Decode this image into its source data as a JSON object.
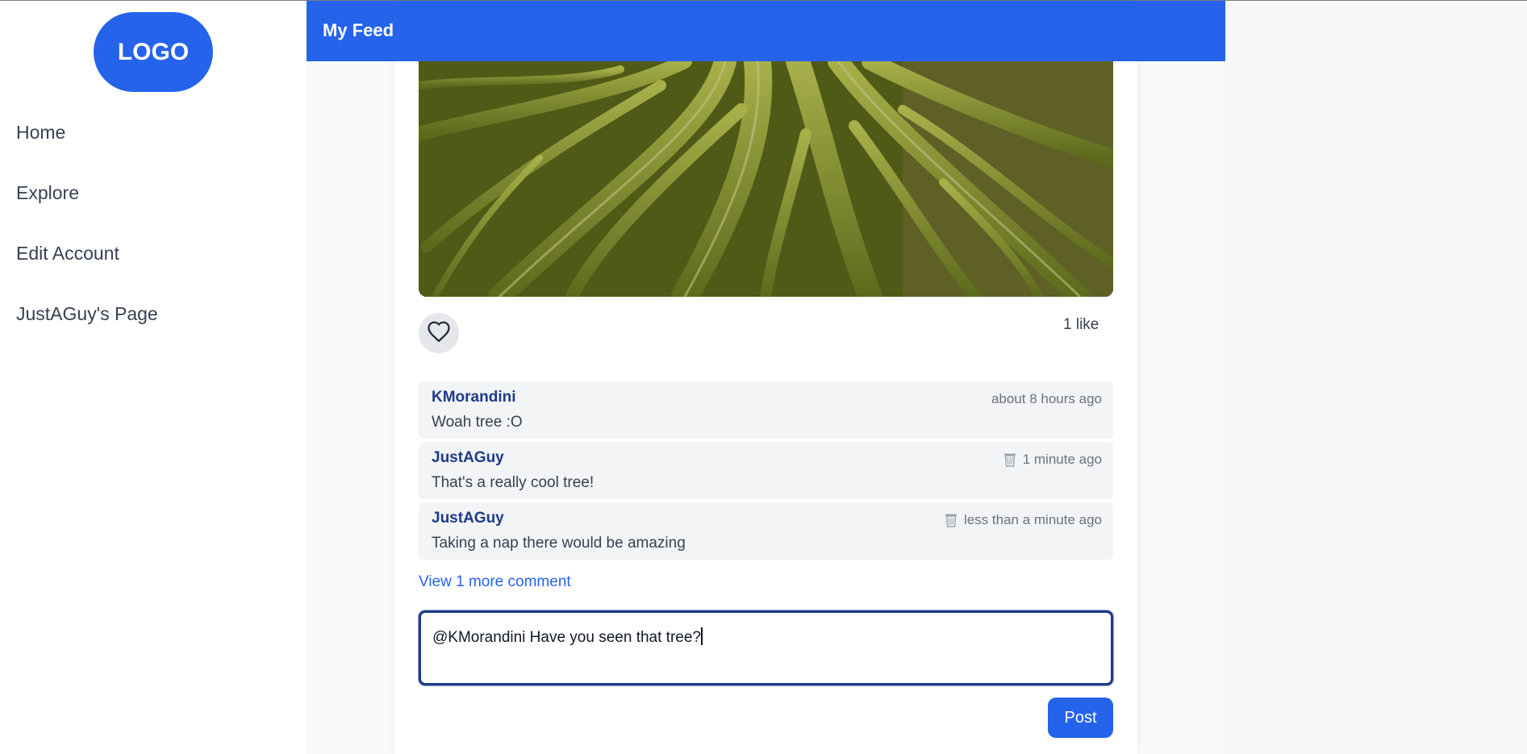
{
  "sidebar": {
    "logo": "LOGO",
    "items": [
      {
        "label": "Home"
      },
      {
        "label": "Explore"
      },
      {
        "label": "Edit Account"
      },
      {
        "label": "JustAGuy's Page"
      }
    ]
  },
  "header": {
    "title": "My Feed"
  },
  "post": {
    "likes": "1 like",
    "comments": [
      {
        "user": "KMorandini",
        "text": "Woah tree :O",
        "time": "about 8 hours ago",
        "deletable": false
      },
      {
        "user": "JustAGuy",
        "text": "That's a really cool tree!",
        "time": "1 minute ago",
        "deletable": true
      },
      {
        "user": "JustAGuy",
        "text": "Taking a nap there would be amazing",
        "time": "less than a minute ago",
        "deletable": true
      }
    ],
    "view_more": "View 1 more comment",
    "comment_input_value": "@KMorandini Have you seen that tree?",
    "post_button": "Post"
  },
  "colors": {
    "accent": "#2563eb",
    "username": "#1e3a8a"
  },
  "icons": {
    "like": "heart-icon",
    "delete": "trash-icon"
  }
}
